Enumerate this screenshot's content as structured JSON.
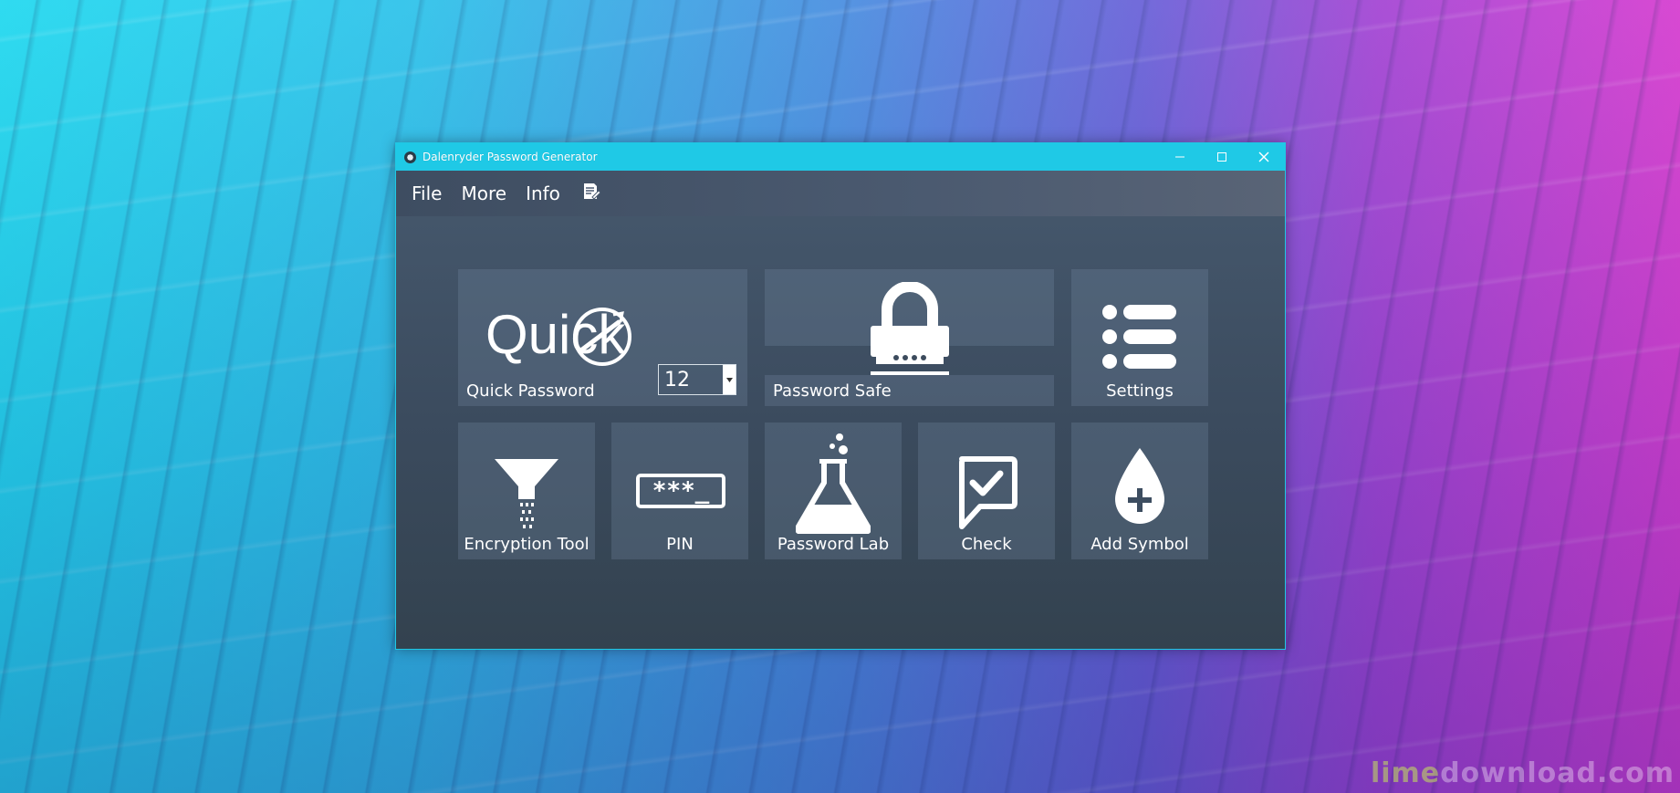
{
  "window": {
    "title": "Dalenryder Password Generator",
    "accent_color": "#1fc9e6"
  },
  "titlebar_controls": {
    "minimize_icon": "minimize-icon",
    "maximize_icon": "maximize-icon",
    "close_icon": "close-icon"
  },
  "menu": {
    "items": [
      {
        "label": "File"
      },
      {
        "label": "More"
      },
      {
        "label": "Info"
      }
    ],
    "notes_icon": "notes-icon"
  },
  "tiles": {
    "quick_password": {
      "label": "Quick Password",
      "logo_text": "Quick",
      "length_value": "12",
      "icon": "speedometer-icon"
    },
    "password_safe": {
      "label": "Password Safe",
      "icon": "padlock-icon"
    },
    "settings": {
      "label": "Settings",
      "icon": "list-icon"
    },
    "encryption_tool": {
      "label": "Encryption Tool",
      "icon": "funnel-icon"
    },
    "pin": {
      "label": "PIN",
      "icon": "pin-field-icon",
      "glyph_text": "***_"
    },
    "password_lab": {
      "label": "Password Lab",
      "icon": "flask-icon"
    },
    "check": {
      "label": "Check",
      "icon": "chat-check-icon"
    },
    "add_symbol": {
      "label": "Add Symbol",
      "icon": "drop-plus-icon"
    }
  },
  "desktop": {
    "watermark_part1": "lime",
    "watermark_part2": "download.com"
  }
}
